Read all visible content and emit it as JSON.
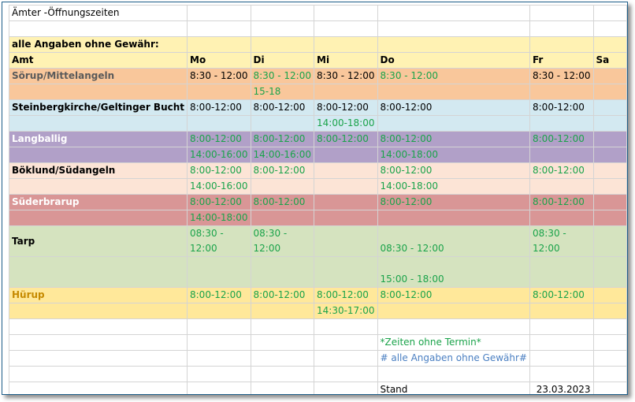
{
  "title": "Ämter -Öffnungszeiten",
  "disclaimer": "alle Angaben ohne Gewähr:",
  "header": {
    "amt": "Amt",
    "mo": "Mo",
    "di": "Di",
    "mi": "Mi",
    "do": "Do",
    "fr": "Fr",
    "sa": "Sa"
  },
  "rows": {
    "soerup": {
      "name": "Sörup/Mittelangeln",
      "mo": "8:30 - 12:00",
      "di": "8:30 - 12:00",
      "mi": "8:30 - 12:00",
      "do": "8:30 - 12:00",
      "fr": "8:30 - 12:00",
      "di2": "15-18"
    },
    "steinberg": {
      "name": "Steinbergkirche/Geltinger Bucht",
      "mo": "8:00-12:00",
      "di": "8:00-12:00",
      "mi": "8:00-12:00",
      "do": "8:00-12:00",
      "fr": "8:00-12:00",
      "mi2": "14:00-18:00"
    },
    "langballig": {
      "name": "Langballig",
      "mo": "8:00-12:00",
      "di": "8:00-12:00",
      "mi": "8:00-12:00",
      "do": "8:00-12:00",
      "fr": "8:00-12:00",
      "mo2": "14:00-16:00",
      "di2": "14:00-16:00",
      "do2": "14:00-18:00"
    },
    "boeklund": {
      "name": "Böklund/Südangeln",
      "mo": "8:00-12:00",
      "di": "8:00-12:00",
      "do": "8:00-12:00",
      "fr": "8:00-12:00",
      "mo2": "14:00-16:00",
      "do2": "14:00-18:00"
    },
    "suederbrarup": {
      "name": "Süderbrarup",
      "mo": "8:00-12:00",
      "di": "8:00-12:00",
      "do": "8:00-12:00",
      "fr": "8:00-12:00",
      "mo2": "14:00-18:00"
    },
    "tarp": {
      "name": "Tarp",
      "mo_a": "08:30 -",
      "mo_b": "12:00",
      "di_a": "08:30 -",
      "di_b": "12:00",
      "fr_a": "08:30 -",
      "fr_b": "12:00",
      "do": "08:30 - 12:00",
      "do2": "15:00 - 18:00"
    },
    "huerup": {
      "name": "Hürup",
      "mo": "8:00-12:00",
      "di": "8:00-12:00",
      "mi": "8:00-12:00",
      "do": "8:00-12:00",
      "fr": "8:00-12:00",
      "mi2": "14:30-17:00"
    }
  },
  "notes": {
    "ohne_termin": "*Zeiten ohne Termin*",
    "ohne_gewaehr": "# alle Angaben ohne Gewähr#"
  },
  "stand": {
    "label": "Stand",
    "date": "23.03.2023"
  },
  "colors": {
    "yellow": "#fff2b3",
    "peach": "#f9c79b",
    "light_blue": "#d3e9f1",
    "purple": "#b1a0c8",
    "pink": "#fce4d6",
    "red": "#d99696",
    "green": "#d5e3bf",
    "gold": "#ffe89a",
    "time_green": "#1aa34a",
    "note_blue": "#4a7fc2"
  }
}
